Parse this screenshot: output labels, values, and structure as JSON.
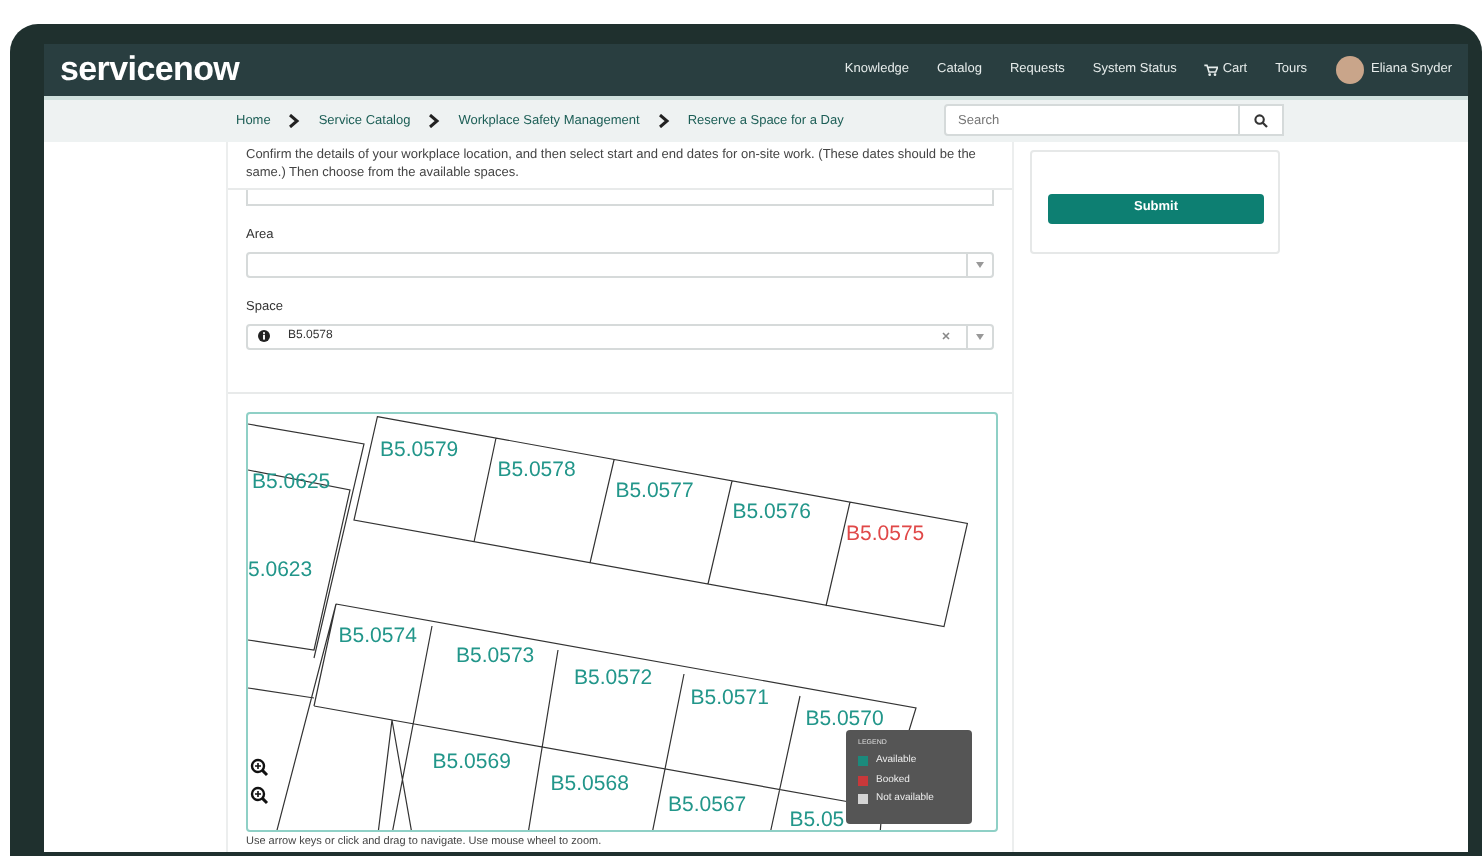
{
  "header": {
    "logo": "servicenow",
    "nav": [
      {
        "label": "Knowledge",
        "kind": "link"
      },
      {
        "label": "Catalog",
        "kind": "link"
      },
      {
        "label": "Requests",
        "kind": "link"
      },
      {
        "label": "System Status",
        "kind": "link"
      },
      {
        "label": "Cart",
        "kind": "cart"
      },
      {
        "label": "Tours",
        "kind": "link"
      }
    ],
    "user": "Eliana Snyder"
  },
  "breadcrumb": [
    "Home",
    "Service Catalog",
    "Workplace Safety Management",
    "Reserve a Space for a Day"
  ],
  "search": {
    "placeholder": "Search"
  },
  "form": {
    "description": "Confirm the details of your workplace location, and then select start and end dates for on-site work. (These dates should be the same.) Then choose from the available spaces.",
    "fields": [
      {
        "label": "Area",
        "info": false,
        "clearable": false
      },
      {
        "label": "Space",
        "value": "B5.0578",
        "info": true,
        "clearable": true
      }
    ]
  },
  "map": {
    "spaces": [
      {
        "label": "B5.0579",
        "booked": false
      },
      {
        "label": "B5.0578",
        "booked": false
      },
      {
        "label": "B5.0577",
        "booked": false
      },
      {
        "label": "B5.0576",
        "booked": false
      },
      {
        "label": "B5.0575",
        "booked": true
      },
      {
        "label": "B5.0625",
        "booked": false
      },
      {
        "label": "5.0623",
        "booked": false
      },
      {
        "label": "B5.0574",
        "booked": false
      },
      {
        "label": "B5.0573",
        "booked": false
      },
      {
        "label": "B5.0572",
        "booked": false
      },
      {
        "label": "B5.0571",
        "booked": false
      },
      {
        "label": "B5.0570",
        "booked": false
      },
      {
        "label": "B5.0569",
        "booked": false
      },
      {
        "label": "B5.0568",
        "booked": false
      },
      {
        "label": "B5.0567",
        "booked": false
      },
      {
        "label": "B5.05",
        "booked": false
      }
    ],
    "legend": {
      "title": "LEGEND",
      "items": [
        {
          "label": "Available",
          "color": "#1b8a7c"
        },
        {
          "label": "Booked",
          "color": "#c8383a"
        },
        {
          "label": "Not available",
          "color": "#d4d4d4"
        }
      ]
    },
    "caption": "Use arrow keys or click and drag to navigate. Use mouse wheel to zoom."
  },
  "submit": "Submit"
}
